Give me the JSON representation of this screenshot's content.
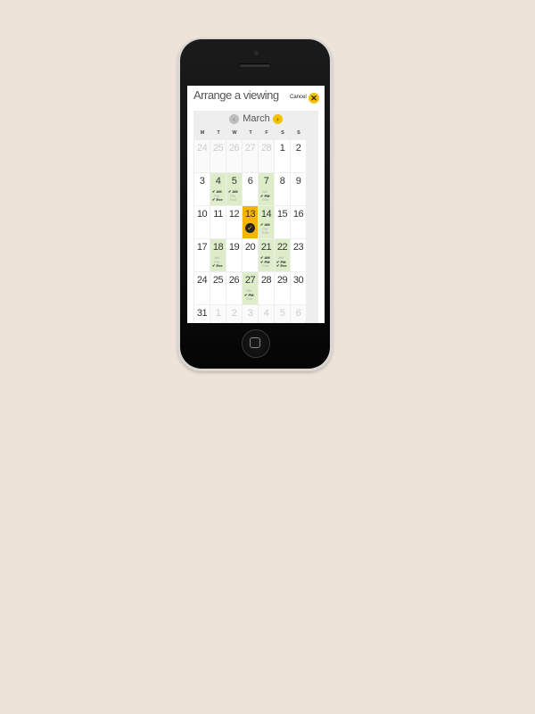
{
  "header": {
    "title": "Arrange a viewing",
    "cancel_label": "Cancel",
    "close_icon": "close-icon"
  },
  "calendar": {
    "month": "March",
    "prev_icon": "chevron-left-icon",
    "next_icon": "chevron-right-icon",
    "accent_color": "#f5b400",
    "available_color": "#ddecc9",
    "weekdays": [
      "M",
      "T",
      "W",
      "T",
      "F",
      "S",
      "S"
    ],
    "weeks": [
      [
        {
          "day": "24",
          "muted": true
        },
        {
          "day": "25",
          "muted": true
        },
        {
          "day": "26",
          "muted": true
        },
        {
          "day": "27",
          "muted": true
        },
        {
          "day": "28",
          "muted": true
        },
        {
          "day": "1"
        },
        {
          "day": "2"
        }
      ],
      [
        {
          "day": "3"
        },
        {
          "day": "4",
          "available": true,
          "slots": [
            {
              "label": "AM",
              "on": true
            },
            {
              "label": "PM",
              "on": false
            },
            {
              "label": "Eve",
              "on": true
            }
          ]
        },
        {
          "day": "5",
          "available": true,
          "slots": [
            {
              "label": "AM",
              "on": true
            },
            {
              "label": "PM",
              "on": false
            },
            {
              "label": "Eve",
              "on": false
            }
          ]
        },
        {
          "day": "6"
        },
        {
          "day": "7",
          "available": true,
          "slots": [
            {
              "label": "AM",
              "on": false
            },
            {
              "label": "PM",
              "on": true
            },
            {
              "label": "Eve",
              "on": false
            }
          ]
        },
        {
          "day": "8"
        },
        {
          "day": "9"
        }
      ],
      [
        {
          "day": "10"
        },
        {
          "day": "11"
        },
        {
          "day": "12"
        },
        {
          "day": "13",
          "selected": true
        },
        {
          "day": "14",
          "available": true,
          "slots": [
            {
              "label": "AM",
              "on": true
            },
            {
              "label": "PM",
              "on": false
            },
            {
              "label": "Eve",
              "on": false
            }
          ]
        },
        {
          "day": "15"
        },
        {
          "day": "16"
        }
      ],
      [
        {
          "day": "17"
        },
        {
          "day": "18",
          "available": true,
          "slots": [
            {
              "label": "AM",
              "on": false
            },
            {
              "label": "PM",
              "on": false
            },
            {
              "label": "Eve",
              "on": true
            }
          ]
        },
        {
          "day": "19"
        },
        {
          "day": "20"
        },
        {
          "day": "21",
          "available": true,
          "slots": [
            {
              "label": "AM",
              "on": true
            },
            {
              "label": "PM",
              "on": true
            },
            {
              "label": "Eve",
              "on": false
            }
          ]
        },
        {
          "day": "22",
          "available": true,
          "slots": [
            {
              "label": "AM",
              "on": false
            },
            {
              "label": "PM",
              "on": true
            },
            {
              "label": "Eve",
              "on": true
            }
          ]
        },
        {
          "day": "23"
        }
      ],
      [
        {
          "day": "24"
        },
        {
          "day": "25"
        },
        {
          "day": "26"
        },
        {
          "day": "27",
          "available": true,
          "slots": [
            {
              "label": "AM",
              "on": false
            },
            {
              "label": "PM",
              "on": true
            },
            {
              "label": "Eve",
              "on": false
            }
          ]
        },
        {
          "day": "28"
        },
        {
          "day": "29"
        },
        {
          "day": "30"
        }
      ],
      [
        {
          "day": "31"
        },
        {
          "day": "1",
          "muted": true
        },
        {
          "day": "2",
          "muted": true
        },
        {
          "day": "3",
          "muted": true
        },
        {
          "day": "4",
          "muted": true
        },
        {
          "day": "5",
          "muted": true
        },
        {
          "day": "6",
          "muted": true
        }
      ]
    ]
  }
}
